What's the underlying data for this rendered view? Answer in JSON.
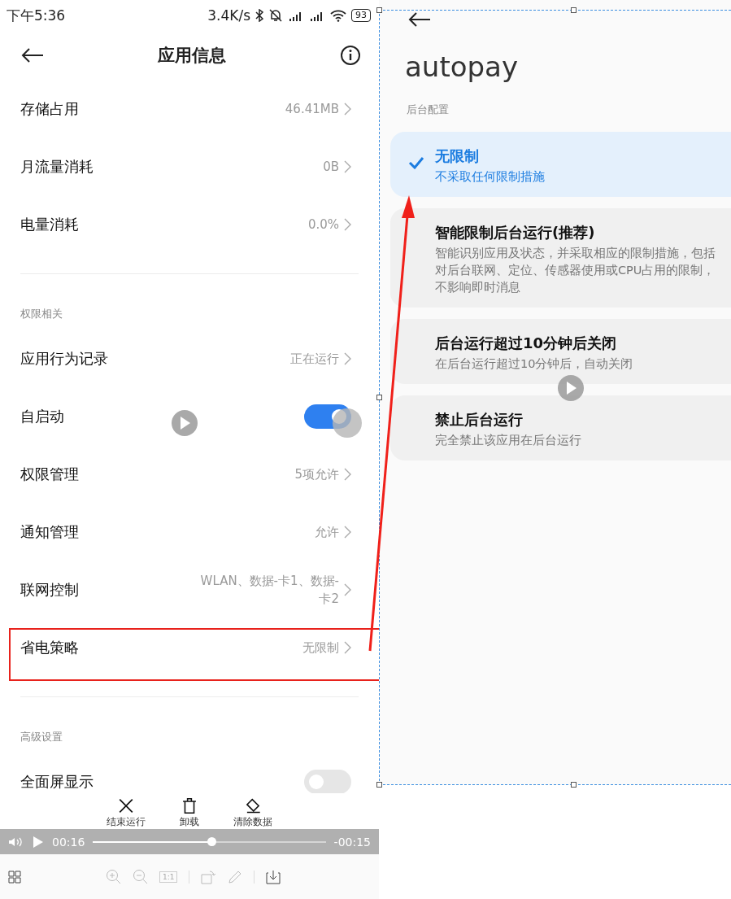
{
  "left_screen": {
    "status_bar": {
      "time": "下午5:36",
      "speed": "3.4K/s",
      "battery": "93"
    },
    "title": "应用信息",
    "sections": [
      {
        "items": [
          {
            "kind": "link",
            "label": "存储占用",
            "value": "46.41MB",
            "highlighted": false
          },
          {
            "kind": "link",
            "label": "月流量消耗",
            "value": "0B",
            "highlighted": false
          },
          {
            "kind": "link",
            "label": "电量消耗",
            "value": "0.0%",
            "highlighted": false
          }
        ]
      },
      {
        "header": "权限相关",
        "items": [
          {
            "kind": "link",
            "label": "应用行为记录",
            "value": "正在运行",
            "highlighted": false
          },
          {
            "kind": "toggle",
            "label": "自启动",
            "on": true
          },
          {
            "kind": "link",
            "label": "权限管理",
            "value": "5项允许",
            "highlighted": false
          },
          {
            "kind": "link",
            "label": "通知管理",
            "value": "允许",
            "highlighted": false
          },
          {
            "kind": "link",
            "label": "联网控制",
            "value": "WLAN、数据-卡1、数据-卡2",
            "highlighted": false
          },
          {
            "kind": "link",
            "label": "省电策略",
            "value": "无限制",
            "highlighted": true
          }
        ]
      },
      {
        "header": "高级设置",
        "items": [
          {
            "kind": "toggle",
            "label": "全面屏显示",
            "on": false
          }
        ]
      }
    ],
    "actions": [
      {
        "kind": "close",
        "label": "结束运行"
      },
      {
        "kind": "trash",
        "label": "卸载"
      },
      {
        "kind": "eraser",
        "label": "清除数据"
      }
    ]
  },
  "player": {
    "elapsed": "00:16",
    "level": 0.51,
    "remaining": "-00:15"
  },
  "toolbar": {
    "actual_size": "1:1"
  },
  "right_screen": {
    "title": "autopay",
    "section": "后台配置",
    "options": [
      {
        "title": "无限制",
        "description": "不采取任何限制措施",
        "selected": true
      },
      {
        "title": "智能限制后台运行(推荐)",
        "description": "智能识别应用及状态，并采取相应的限制措施，包括对后台联网、定位、传感器使用或CPU占用的限制，不影响即时消息",
        "selected": false
      },
      {
        "title": "后台运行超过10分钟后关闭",
        "description": "在后台运行超过10分钟后，自动关闭",
        "selected": false
      },
      {
        "title": "禁止后台运行",
        "description": "完全禁止该应用在后台运行",
        "selected": false
      }
    ]
  }
}
